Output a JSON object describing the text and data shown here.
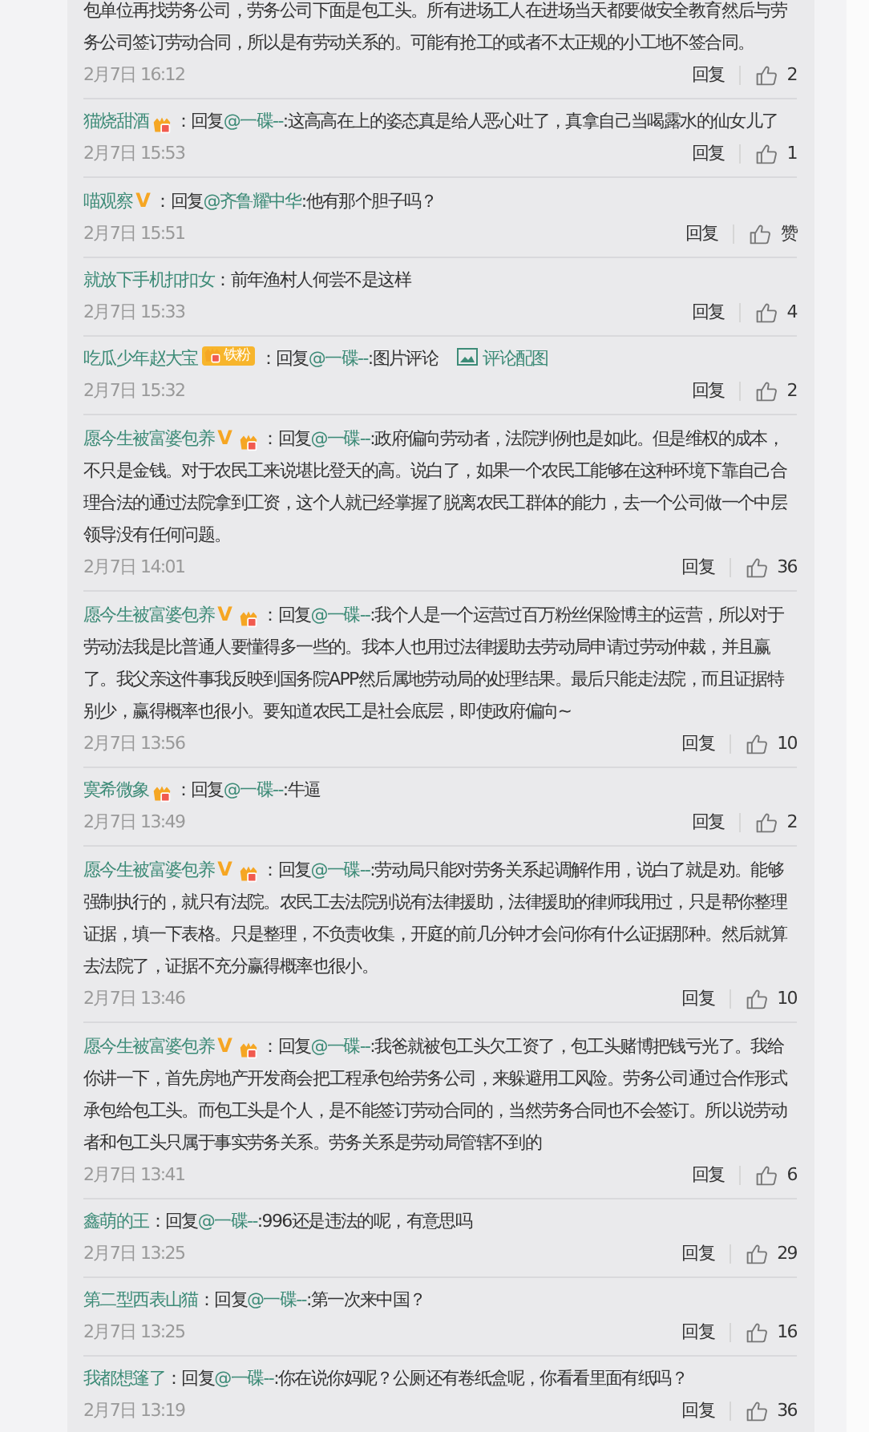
{
  "comments": [
    {
      "text": "包单位再找劳务公司，劳务公司下面是包工头。所有进场工人在进场当天都要做安全教育然后与劳务公司签订劳动合同，所以是有劳动关系的。可能有抢工的或者不太正规的小工地不签合同。",
      "date": "2月7日 16:12",
      "reply": "回复",
      "likes": "2"
    },
    {
      "user": "猫烧甜酒",
      "badges": [
        {
          "kind": "fan"
        }
      ],
      "lead": "：回复",
      "mention": "@一碟--",
      "text": ":这高高在上的姿态真是给人恶心吐了，真拿自己当喝露水的仙女儿了",
      "date": "2月7日 15:53",
      "reply": "回复",
      "likes": "1"
    },
    {
      "user": "喵观察",
      "badges": [
        {
          "kind": "vip",
          "label": "V"
        }
      ],
      "lead": "：回复",
      "mention": "@齐鲁耀中华",
      "text": ":他有那个胆子吗？",
      "date": "2月7日 15:51",
      "reply": "回复",
      "likes": "赞"
    },
    {
      "user": "就放下手机扣扣女",
      "lead": "：",
      "text": "前年渔村人何尝不是这样",
      "date": "2月7日 15:33",
      "reply": "回复",
      "likes": "4"
    },
    {
      "user": "吃瓜少年赵大宝",
      "badges": [
        {
          "kind": "iron_fan",
          "label": "铁粉"
        }
      ],
      "lead": "：回复",
      "mention": "@一碟--",
      "text": ":图片评论",
      "image_link": "评论配图",
      "date": "2月7日 15:32",
      "reply": "回复",
      "likes": "2"
    },
    {
      "user": "愿今生被富婆包养",
      "badges": [
        {
          "kind": "vip",
          "label": "V"
        },
        {
          "kind": "fan"
        }
      ],
      "lead": "：回复",
      "mention": "@一碟--",
      "text": ":政府偏向劳动者，法院判例也是如此。但是维权的成本，不只是金钱。对于农民工来说堪比登天的高。说白了，如果一个农民工能够在这种环境下靠自己合理合法的通过法院拿到工资，这个人就已经掌握了脱离农民工群体的能力，去一个公司做一个中层领导没有任何问题。",
      "date": "2月7日 14:01",
      "reply": "回复",
      "likes": "36"
    },
    {
      "user": "愿今生被富婆包养",
      "badges": [
        {
          "kind": "vip",
          "label": "V"
        },
        {
          "kind": "fan"
        }
      ],
      "lead": "：回复",
      "mention": "@一碟--",
      "text": ":我个人是一个运营过百万粉丝保险博主的运营，所以对于劳动法我是比普通人要懂得多一些的。我本人也用过法律援助去劳动局申请过劳动仲裁，并且赢了。我父亲这件事我反映到国务院APP然后属地劳动局的处理结果。最后只能走法院，而且证据特别少，赢得概率也很小。要知道农民工是社会底层，即使政府偏向~",
      "date": "2月7日 13:56",
      "reply": "回复",
      "likes": "10"
    },
    {
      "user": "寞希微象",
      "badges": [
        {
          "kind": "fan"
        }
      ],
      "lead": "：回复",
      "mention": "@一碟--",
      "text": ":牛逼",
      "date": "2月7日 13:49",
      "reply": "回复",
      "likes": "2"
    },
    {
      "user": "愿今生被富婆包养",
      "badges": [
        {
          "kind": "vip",
          "label": "V"
        },
        {
          "kind": "fan"
        }
      ],
      "lead": "：回复",
      "mention": "@一碟--",
      "text": ":劳动局只能对劳务关系起调解作用，说白了就是劝。能够强制执行的，就只有法院。农民工去法院别说有法律援助，法律援助的律师我用过，只是帮你整理证据，填一下表格。只是整理，不负责收集，开庭的前几分钟才会问你有什么证据那种。然后就算去法院了，证据不充分赢得概率也很小。",
      "date": "2月7日 13:46",
      "reply": "回复",
      "likes": "10"
    },
    {
      "user": "愿今生被富婆包养",
      "badges": [
        {
          "kind": "vip",
          "label": "V"
        },
        {
          "kind": "fan"
        }
      ],
      "lead": "：回复",
      "mention": "@一碟--",
      "text": ":我爸就被包工头欠工资了，包工头赌博把钱亏光了。我给你讲一下，首先房地产开发商会把工程承包给劳务公司，来躲避用工风险。劳务公司通过合作形式承包给包工头。而包工头是个人，是不能签订劳动合同的，当然劳务合同也不会签订。所以说劳动者和包工头只属于事实劳务关系。劳务关系是劳动局管辖不到的",
      "date": "2月7日 13:41",
      "reply": "回复",
      "likes": "6"
    },
    {
      "user": "鑫萌的王",
      "lead": "：回复",
      "mention": "@一碟--",
      "text": ":996还是违法的呢，有意思吗",
      "date": "2月7日 13:25",
      "reply": "回复",
      "likes": "29"
    },
    {
      "user": "第二型西表山猫",
      "lead": "：回复",
      "mention": "@一碟--",
      "text": ":第一次来中国？",
      "date": "2月7日 13:25",
      "reply": "回复",
      "likes": "16"
    },
    {
      "user": "我都想篷了",
      "lead": "：回复",
      "mention": "@一碟--",
      "text": ":你在说你妈呢？公厕还有卷纸盒呢，你看看里面有纸吗？",
      "date": "2月7日 13:19",
      "reply": "回复",
      "likes": "36"
    }
  ]
}
